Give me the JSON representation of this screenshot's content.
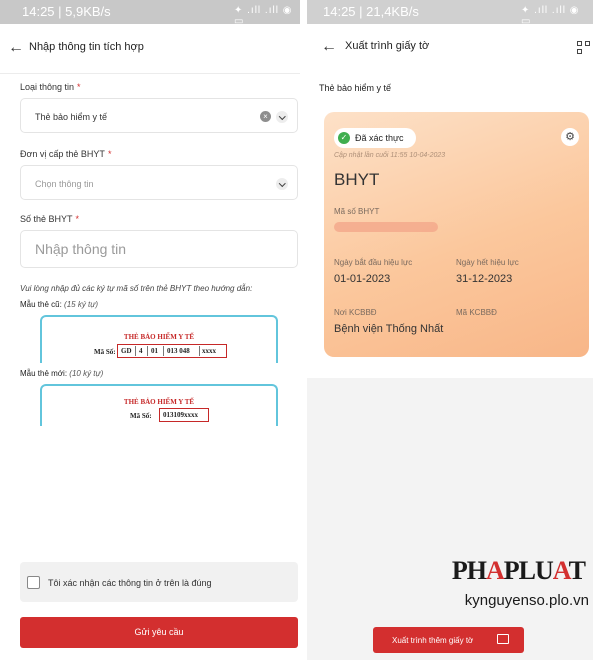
{
  "left_screen": {
    "status_bar": {
      "time_text": "14:25 | 5,9KB/s",
      "indicators": "✦ .ıll .ıll ◉ ▭"
    },
    "header": {
      "title": "Nhập thông tin tích hợp"
    },
    "fields": {
      "info_type": {
        "label": "Loại thông tin",
        "value": "Thẻ bảo hiểm y tế"
      },
      "issuer": {
        "label": "Đơn vị cấp thẻ BHYT",
        "placeholder": "Chọn thông tin"
      },
      "card_number": {
        "label": "Số thẻ BHYT",
        "placeholder": "Nhập thông tin"
      },
      "required_mark": "*"
    },
    "hint": "Vui lòng nhập đủ các ký tự mã số trên thẻ BHYT theo hướng dẫn:",
    "old_sample": {
      "label": "Mẫu thẻ cũ:",
      "note": "(15 ký tự)",
      "card_title": "THẺ BẢO HIỂM Y TẾ",
      "code_label": "Mã Số:",
      "code_parts": [
        "GD",
        "4",
        "01",
        "013 048",
        "xxxx"
      ]
    },
    "new_sample": {
      "label": "Mẫu thẻ mới:",
      "note": "(10 ký tự)",
      "card_title": "THẺ BẢO HIỂM Y TẾ",
      "code_label": "Mã Số:",
      "code": "013109xxxx"
    },
    "confirm_text": "Tôi xác nhận các thông tin ở trên là đúng",
    "submit_label": "Gửi yêu cầu"
  },
  "right_screen": {
    "status_bar": {
      "time_text": "14:25 | 21,4KB/s",
      "indicators": "✦ .ıll .ıll ◉ ▭"
    },
    "header": {
      "title": "Xuất trình giấy tờ"
    },
    "section_title": "Thẻ bảo hiểm y tế",
    "card": {
      "verified": "Đã xác thực",
      "updated": "Cập nhật lần cuối 11:55 10-04-2023",
      "type": "BHYT",
      "number_label": "Mã số BHYT",
      "valid_from_label": "Ngày bắt đầu hiệu lực",
      "valid_from": "01-01-2023",
      "valid_to_label": "Ngày hết hiệu lực",
      "valid_to": "31-12-2023",
      "kcb_place_label": "Nơi KCBBĐ",
      "kcb_place": "Bệnh viện Thống Nhất",
      "kcb_code_label": "Mã KCBBĐ"
    },
    "export_button": "Xuất trình thêm giấy tờ"
  },
  "watermark": {
    "brand_part1": "PH",
    "brand_accent": "A",
    "brand_part2": "PLU",
    "brand_accent2": "A",
    "brand_part3": "T",
    "url": "kynguyenso.plo.vn"
  },
  "colors": {
    "primary_red": "#d32f2f",
    "card_peach": "#fbc79c",
    "verified_green": "#3fae4f",
    "sample_border": "#62c5dc"
  }
}
